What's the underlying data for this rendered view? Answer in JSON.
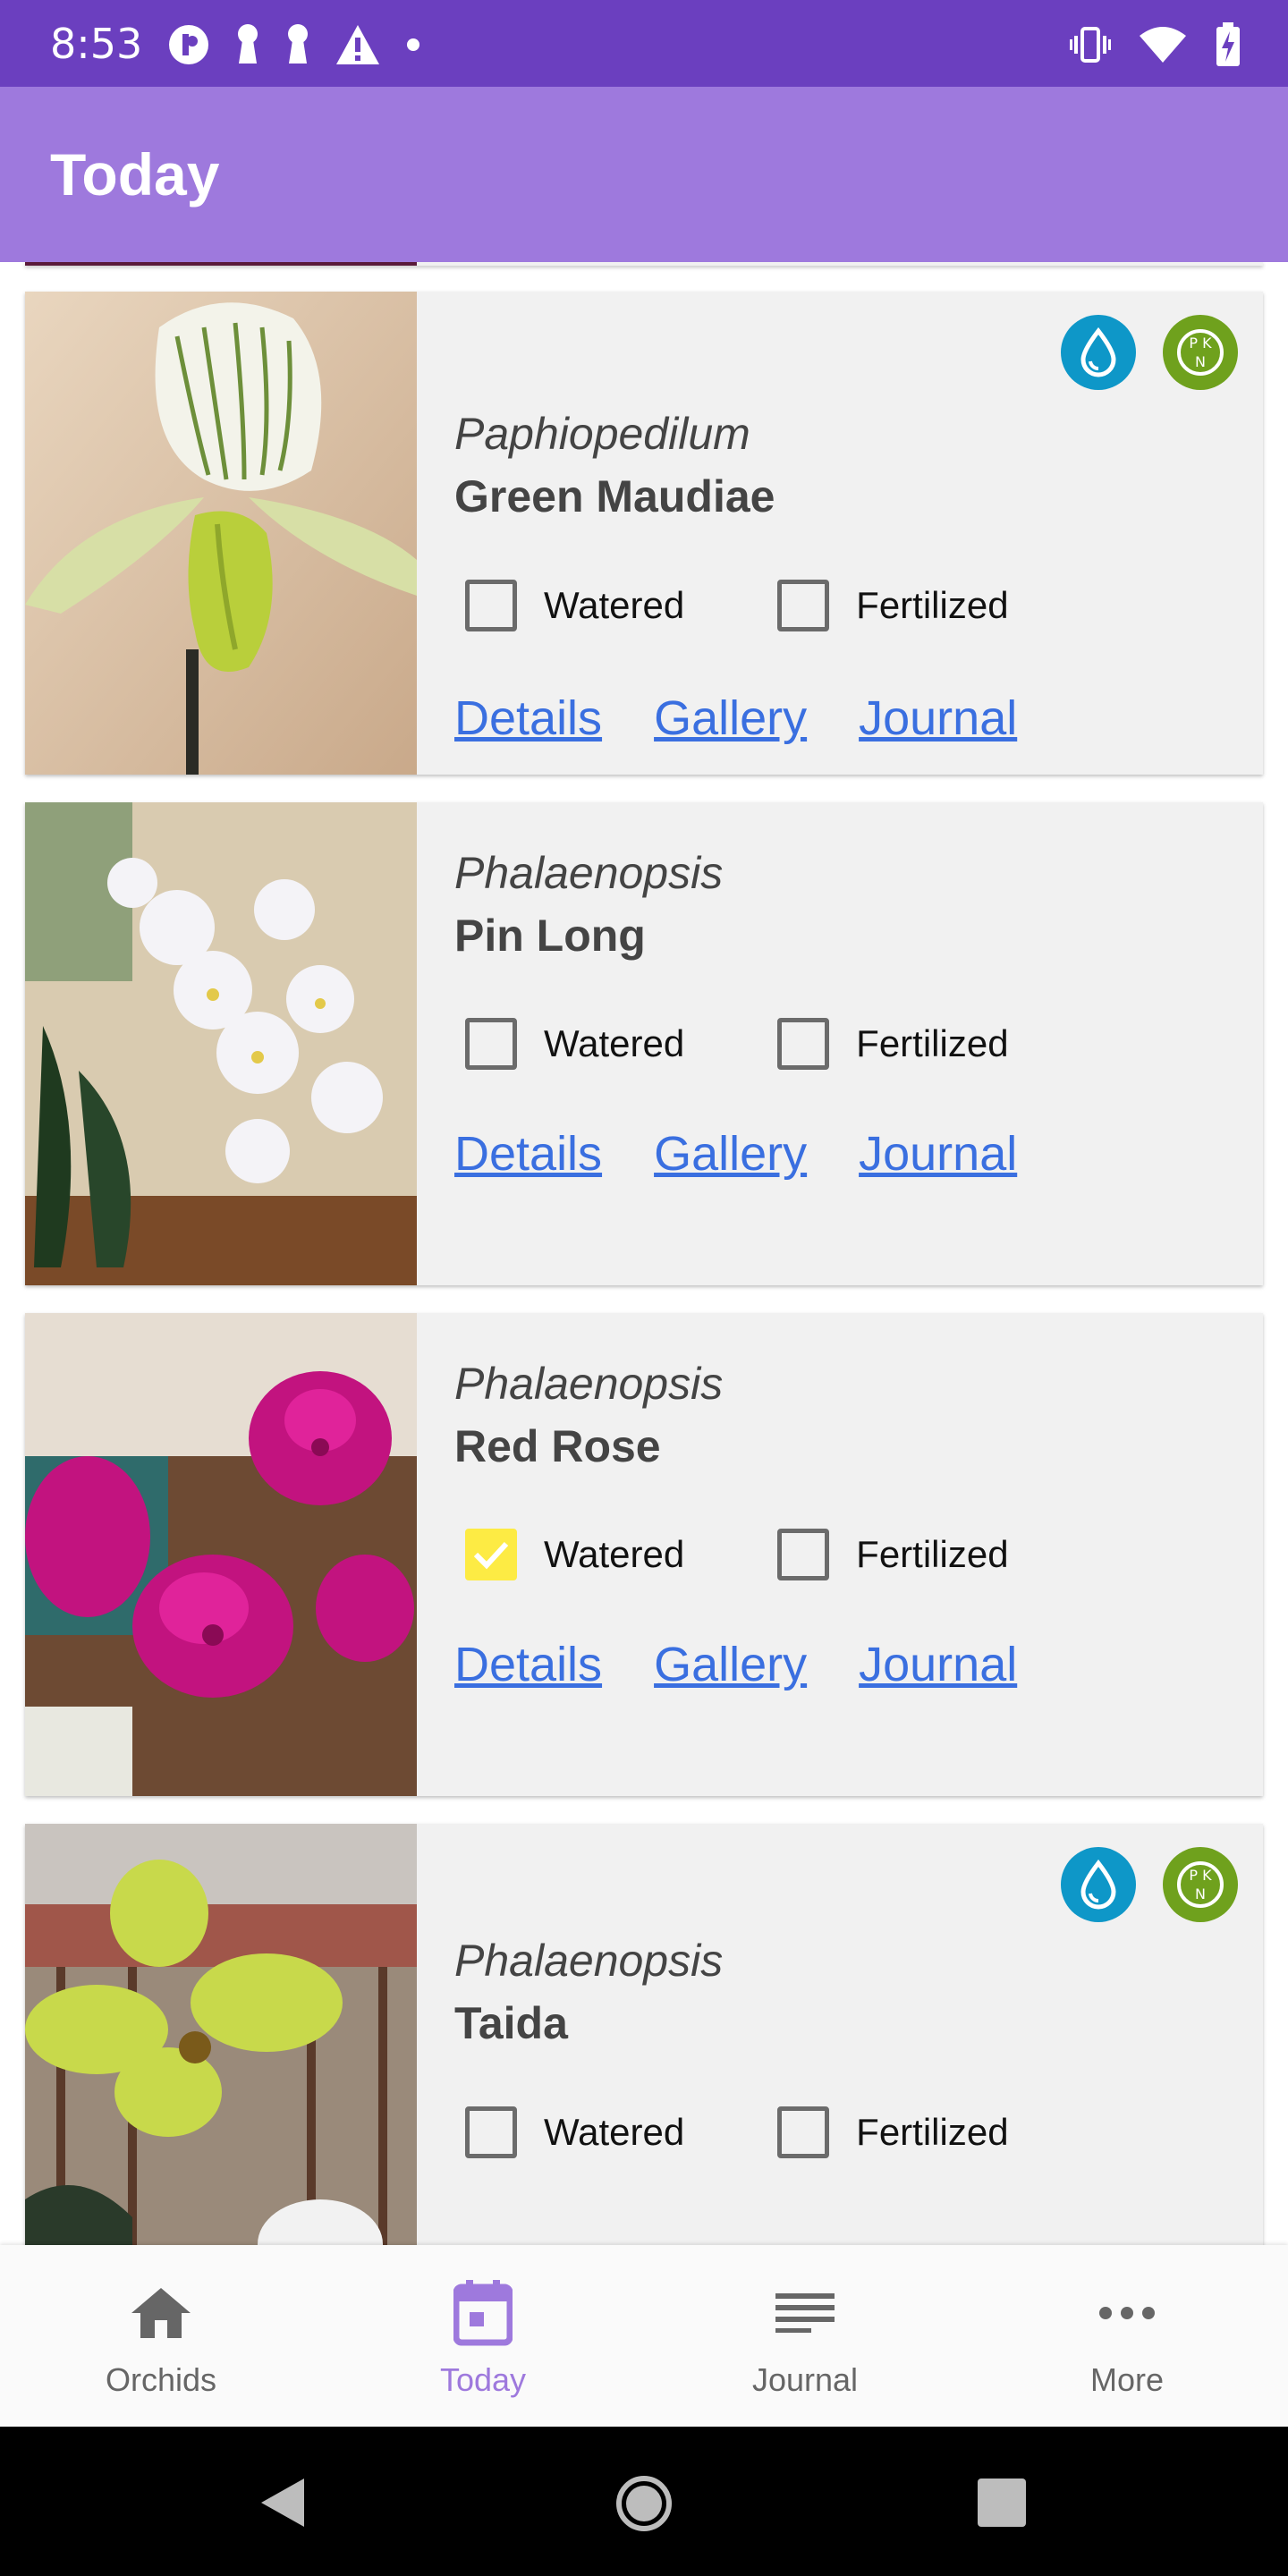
{
  "status_bar": {
    "time": "8:53",
    "left_icons": [
      "app-notification-icon",
      "keyhole-icon",
      "keyhole-icon",
      "warning-icon",
      "dot-icon"
    ],
    "right_icons": [
      "vibrate-icon",
      "wifi-icon",
      "battery-charging-icon"
    ]
  },
  "app_bar": {
    "title": "Today"
  },
  "cards": [
    {
      "genus": "Paphiopedilum",
      "name": "Green Maudiae",
      "watered_label": "Watered",
      "watered_checked": false,
      "fertilized_label": "Fertilized",
      "fertilized_checked": false,
      "details_label": "Details",
      "gallery_label": "Gallery",
      "journal_label": "Journal",
      "badges": [
        "water-drop-icon",
        "fertilizer-icon"
      ]
    },
    {
      "genus": "Phalaenopsis",
      "name": "Pin Long",
      "watered_label": "Watered",
      "watered_checked": false,
      "fertilized_label": "Fertilized",
      "fertilized_checked": false,
      "details_label": "Details",
      "gallery_label": "Gallery",
      "journal_label": "Journal",
      "badges": []
    },
    {
      "genus": "Phalaenopsis",
      "name": "Red Rose",
      "watered_label": "Watered",
      "watered_checked": true,
      "fertilized_label": "Fertilized",
      "fertilized_checked": false,
      "details_label": "Details",
      "gallery_label": "Gallery",
      "journal_label": "Journal",
      "badges": []
    },
    {
      "genus": "Phalaenopsis",
      "name": "Taida",
      "watered_label": "Watered",
      "watered_checked": false,
      "fertilized_label": "Fertilized",
      "fertilized_checked": false,
      "badges": [
        "water-drop-icon",
        "fertilizer-icon"
      ]
    }
  ],
  "bottom_nav": [
    {
      "label": "Orchids",
      "icon": "home-icon",
      "active": false
    },
    {
      "label": "Today",
      "icon": "calendar-icon",
      "active": true
    },
    {
      "label": "Journal",
      "icon": "notes-icon",
      "active": false
    },
    {
      "label": "More",
      "icon": "more-icon",
      "active": false
    }
  ],
  "colors": {
    "status_bar": "#6b3fbf",
    "app_bar": "#9e79dd",
    "link": "#3a6fe0",
    "water_badge": "#0e97c8",
    "fertilizer_badge": "#6fa11d",
    "checkbox_checked": "#fdeb44",
    "nav_active": "#9e79dd"
  }
}
